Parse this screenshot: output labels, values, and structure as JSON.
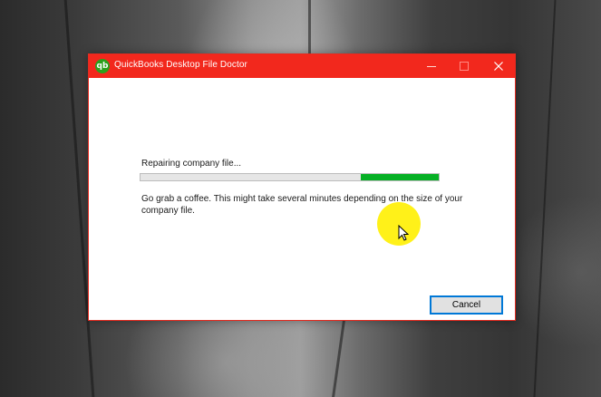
{
  "window": {
    "title": "QuickBooks Desktop File Doctor",
    "app_icon_glyph": "qb",
    "accent_color": "#f2281d",
    "controls": {
      "minimize": "minimize-icon",
      "maximize": "maximize-icon",
      "close": "close-icon"
    }
  },
  "progress": {
    "label": "Repairing company file...",
    "indeterminate_segment_start": 0.74,
    "indeterminate_segment_end": 1.0,
    "fill_color": "#06b025"
  },
  "message": "Go grab a coffee. This might take several minutes depending on the size of your company file.",
  "buttons": {
    "cancel_label": "Cancel"
  },
  "cursor": {
    "icon": "arrow-cursor-icon",
    "highlight_color": "#fff000"
  }
}
